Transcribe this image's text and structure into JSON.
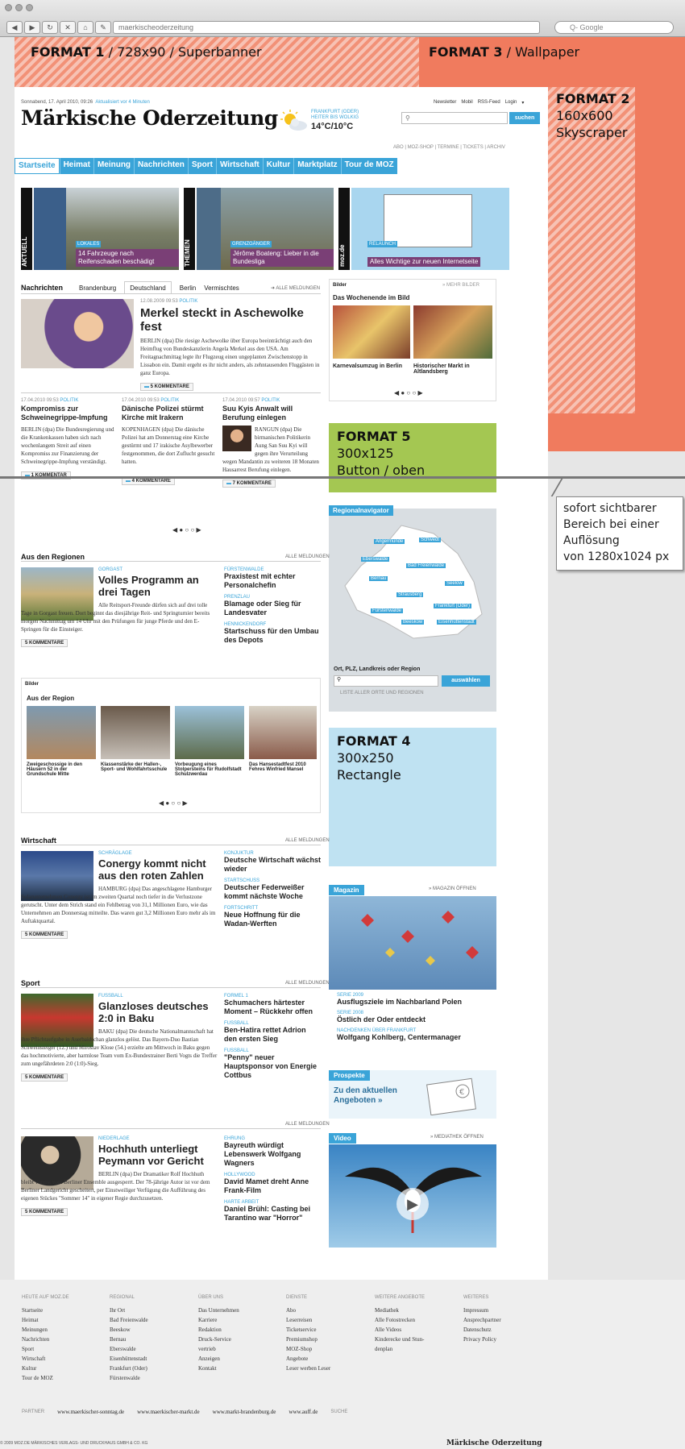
{
  "browser": {
    "url": "maerkischeoderzeitung",
    "search_placeholder": "Q- Google",
    "nav_icons": [
      "back-icon",
      "forward-icon",
      "reload-icon",
      "home-icon",
      "bookmark-icon",
      "site-icon"
    ]
  },
  "formats": {
    "f1_b": "FORMAT 1",
    "f1_r": " / 728x90 / Superbanner",
    "f3_b": "FORMAT 3",
    "f3_r": " / Wallpaper",
    "f2_l1": "FORMAT 2",
    "f2_l2": "160x600",
    "f2_l3": "Skyscraper",
    "f5_l1": "FORMAT 5",
    "f5_l2": "300x125",
    "f5_l3": "Button / oben",
    "f4_l1": "FORMAT 4",
    "f4_l2": "300x250",
    "f4_l3": "Rectangle"
  },
  "callout": {
    "l1": "sofort sichtbarer",
    "l2": "Bereich bei einer",
    "l3": "Auflösung",
    "l4": "von 1280x1024 px"
  },
  "header": {
    "date": "Sonnabend, 17. April 2010, 09:26",
    "updated": "Aktualisiert vor 4 Minuten",
    "top_links": [
      "Newsletter",
      "Mobil",
      "RSS-Feed",
      "Login"
    ],
    "logo": "Märkische Oderzeitung",
    "weather_city": "FRANKFURT (ODER)",
    "weather_desc": "HEITER BIS WOLKIG",
    "weather_temp": "14°C/10°C",
    "search_btn": "suchen",
    "sub_links": "ABO | MOZ-SHOP | TERMINE | TICKETS | ARCHIV"
  },
  "nav": [
    "Startseite",
    "Heimat",
    "Meinung",
    "Nachrichten",
    "Sport",
    "Wirtschaft",
    "Kultur",
    "Marktplatz",
    "Tour de MOZ"
  ],
  "teasers": {
    "tab1": "AKTUELL",
    "tab2": "THEMEN",
    "tab3": "moz.de",
    "t1_kick": "LOKALES",
    "t1_title": "14 Fahrzeuge nach Reifenschaden beschädigt",
    "t2_kick": "GRENZGÄNGER",
    "t2_title": "Jérôme Boateng: Lieber in die Bundesliga",
    "t3_kick": "RELAUNCH",
    "t3_title": "Alles Wichtige zur neuen Internetseite"
  },
  "news": {
    "title": "Nachrichten",
    "tabs": [
      "Brandenburg",
      "Deutschland",
      "Berlin",
      "Vermischtes"
    ],
    "alle": "ALLE MELDUNGEN",
    "lead_meta": "12.08.2009 09:53",
    "lead_kick": "POLITIK",
    "lead_title": "Merkel steckt in Aschewolke fest",
    "lead_body": "BERLIN (dpa) Die riesige Aschewolke über Europa beeinträchtigt auch den Heimflug von Bundeskanzlerin Angela Merkel aus den USA. Am Freitagnachmittag legte ihr Flugzeug einen ungeplanten Zwischenstopp in Lissabon ein. Damit ergeht es ihr nicht anders, als zehntausenden Fluggästen in ganz Europa.",
    "lead_kom": "5 KOMMENTARE",
    "items": [
      {
        "meta": "17.04.2010 09:53",
        "kick": "POLITIK",
        "title": "Kompromiss zur Schweinegrippe-Impfung",
        "body": "BERLIN (dpa) Die Bundesregierung und die Krankenkassen haben sich nach wochenlangem Streit auf einen Kompromiss zur Finanzierung der Schweinegrippe-Impfung verständigt.",
        "kom": "1 KOMMENTAR"
      },
      {
        "meta": "17.04.2010 09:53",
        "kick": "POLITIK",
        "title": "Dänische Polizei stürmt Kirche mit Irakern",
        "body": "KOPENHAGEN (dpa) Die dänische Polizei hat am Donnerstag eine Kirche gestürmt und 17 irakische Asylbewerber festgenommen, die dort Zuflucht gesucht hatten.",
        "kom": "4 KOMMENTARE"
      },
      {
        "meta": "17.04.2010 09:57",
        "kick": "POLITIK",
        "title": "Suu Kyis Anwalt will Berufung einlegen",
        "body": "RANGUN (dpa) Die birmanischen Politikerin Aung San Suu Kyi will gegen ihre Verurteilung wegen Mandantin zu weiteren 18 Monaten Hausarrest Berufung einlegen.",
        "kom": "7 KOMMENTARE"
      }
    ]
  },
  "bilder": {
    "title": "Bilder",
    "more": "» MEHR BILDER",
    "caption": "Das Wochenende im Bild",
    "c1": "Karnevalsumzug in Berlin",
    "c2": "Historischer Markt in Altlandsberg"
  },
  "regionen": {
    "title": "Aus den Regionen",
    "alle": "ALLE MELDUNGEN",
    "kick": "GORGAST",
    "head": "Volles Programm an drei Tagen",
    "body": "Alle Reitsport-Freunde dürfen sich auf drei tolle Tage in Gorgast freuen. Dort beginnt das diesjährige Reit- und Springturnier bereits morgen Nachmittag um 14 Uhr mit den Prüfungen für junge Pferde und den E-Springen für die Einsteiger.",
    "kom": "5 KOMMENTARE",
    "side": [
      {
        "kick": "FÜRSTENWALDE",
        "title": "Praxistest mit echter Personalchefin"
      },
      {
        "kick": "PRENZLAU",
        "title": "Blamage oder Sieg für Landesvater"
      },
      {
        "kick": "HENNICKENDORF",
        "title": "Startschuss für den Umbau des Depots"
      }
    ]
  },
  "regnav": {
    "title": "Regionalnavigator",
    "label": "Ort, PLZ, Landkreis oder Region",
    "btn": "auswählen",
    "list": "LISTE ALLER ORTE UND REGIONEN",
    "places": [
      "Angermünde",
      "Schwedt",
      "Eberswalde",
      "Bad Freienwalde",
      "Bernau",
      "Seelow",
      "Strausberg",
      "Frankfurt (Oder)",
      "Fürstenwalde",
      "Beeskow",
      "Eisenhüttenstadt"
    ]
  },
  "gallery2": {
    "title": "Bilder",
    "caption": "Aus der Region",
    "c1": "Zweigeschossige in den Häusern 52 in der Grundschule Mitte",
    "c2": "Klassenstärke der Hallen-, Sport- und Wohlfahrtsschule",
    "c3": "Vorbeugung eines Stolpersteins für Rudolfstadt Schulzwerdau",
    "c4": "Das Hansestadtfest 2010 Fehres Winfried Mansel"
  },
  "wirtschaft": {
    "title": "Wirtschaft",
    "alle": "ALLE MELDUNGEN",
    "kick": "SCHRÄGLAGE",
    "head": "Conergy kommt nicht aus den roten Zahlen",
    "body": "HAMBURG (dpa) Das angeschlagene Hamburger Solarunternehmen Conergy ist im zweiten Quartal noch tiefer in die Verlustzone gerutscht. Unter dem Strich stand ein Fehlbetrag von 31,1 Millionen Euro, wie das Unternehmen am Donnerstag mitteilte. Das waren gut 3,2 Millionen Euro mehr als im Auftaktquartal.",
    "kom": "5 KOMMENTARE",
    "side": [
      {
        "kick": "KONJUKTUR",
        "title": "Deutsche Wirtschaft wächst wieder"
      },
      {
        "kick": "STARTSCHUSS",
        "title": "Deutscher Federweißer kommt nächste Woche"
      },
      {
        "kick": "FORTSCHRITT",
        "title": "Neue Hoffnung für die Wadan-Werften"
      }
    ]
  },
  "sport": {
    "title": "Sport",
    "alle": "ALLE MELDUNGEN",
    "kick": "FUSSBALL",
    "head": "Glanzloses deutsches 2:0 in Baku",
    "body": "BAKU (dpa) Die deutsche Nationalmannschaft hat ihre Pflichtaufgabe in Aserbaidschan glanzlos gelöst. Das Bayern-Duo Bastian Schweinsteiger (12.) und Miroslav Klose (54.) erzielte am Mittwoch in Baku gegen das hochmotivierte, aber harmlose Team vom Ex-Bundestrainer Berti Vogts die Treffer zum ungefährdeten 2:0 (1:0)-Sieg.",
    "kom": "5 KOMMENTARE",
    "side": [
      {
        "kick": "FORMEL 1",
        "title": "Schumachers härtester Moment – Rückkehr offen"
      },
      {
        "kick": "FUSSBALL",
        "title": "Ben-Hatira rettet Adrion den ersten Sieg"
      },
      {
        "kick": "FUSSBALL",
        "title": "\"Penny\" neuer Hauptsponsor von Energie Cottbus"
      }
    ]
  },
  "kultur": {
    "alle": "ALLE MELDUNGEN",
    "kick": "NIEDERLAGE",
    "head": "Hochhuth unterliegt Peymann vor Gericht",
    "body": "BERLIN (dpa) Der Dramatiker Rolf Hochhuth bleibt vorerst vom Berliner Ensemble ausgesperrt. Der 78-jährige Autor ist vor dem Berliner Landgericht gescheitert, per Einstweiliger Verfügung die Aufführung des eigenen Stückes \"Sommer 14\" in eigener Regie durchzusetzen.",
    "kom": "5 KOMMENTARE",
    "side": [
      {
        "kick": "EHRUNG",
        "title": "Bayreuth würdigt Lebenswerk Wolfgang Wagners"
      },
      {
        "kick": "HOLLYWOOD",
        "title": "David Mamet dreht Anne Frank-Film"
      },
      {
        "kick": "HARTE ARBEIT",
        "title": "Daniel Brühl: Casting bei Tarantino war \"Horror\""
      }
    ]
  },
  "magazin": {
    "title": "Magazin",
    "more": "» MAGAZIN ÖFFNEN",
    "items": [
      {
        "kick": "SERIE 2009",
        "title": "Ausflugsziele im Nachbarland Polen"
      },
      {
        "kick": "SERIE 2008",
        "title": "Östlich der Oder entdeckt"
      },
      {
        "kick": "NACHDENKEN ÜBER FRANKFURT",
        "title": "Wolfgang Kohlberg, Centermanager"
      }
    ]
  },
  "prospekte": {
    "title": "Prospekte",
    "text": "Zu den aktuellen Angeboten »"
  },
  "video": {
    "title": "Video",
    "more": "» MEDIATHEK ÖFFNEN"
  },
  "footer": {
    "cols": [
      {
        "h": "HEUTE AUF MOZ.DE",
        "items": [
          "Startseite",
          "Heimat",
          "Meinungen",
          "Nachrichten",
          "Sport",
          "Wirtschaft",
          "Kultur",
          "Tour de MOZ"
        ]
      },
      {
        "h": "REGIONAL",
        "items": [
          "Ihr Ort",
          "Bad Freienwalde",
          "Beeskow",
          "Bernau",
          "Eberswalde",
          "Eisenhüttenstadt",
          "Frankfurt (Oder)",
          "Fürstenwalde"
        ]
      },
      {
        "h": "ÜBER UNS",
        "items": [
          "Das Unternehmen",
          "Karriere",
          "Redaktion",
          "Druck-Service",
          "vertrieb",
          "Anzeigen",
          "Kontakt"
        ]
      },
      {
        "h": "DIENSTE",
        "items": [
          "Abo",
          "Leserreisen",
          "Ticketservice",
          "Premiumshop",
          "MOZ-Shop",
          "Angebote",
          "Leser werben Leser"
        ]
      },
      {
        "h": "WEITERE ANGEBOTE",
        "items": [
          "Mediathek",
          "Alle Fotostrecken",
          "Alle Videos",
          "Kinderecke und Stun-",
          "denplan"
        ]
      },
      {
        "h": "WEITERES",
        "items": [
          "Impressum",
          "Ansprechpartner",
          "Datenschutz",
          "Privacy Policy"
        ]
      }
    ],
    "partner_label": "PARTNER",
    "partners": [
      "www.maerkischer-sonntag.de",
      "www.maerkischer-markt.de",
      "www.markt-brandenburg.de",
      "www.auff.de"
    ],
    "suche": "SUCHE",
    "copyright": "© 2009 MOZ.DE MÄRKISCHES VERLAGS- UND DRUCKHAUS GMBH & CO. KG",
    "logo": "Märkische Oderzeitung"
  }
}
